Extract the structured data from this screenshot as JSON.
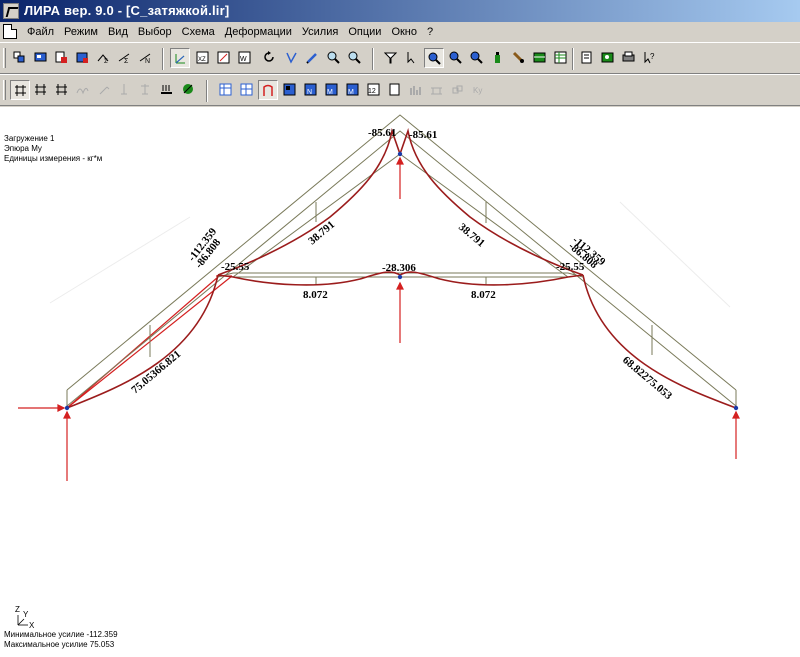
{
  "window": {
    "title": "ЛИРА  вер. 9.0 - [С_затяжкой.lir]"
  },
  "menu": [
    "Файл",
    "Режим",
    "Вид",
    "Выбор",
    "Схема",
    "Деформации",
    "Усилия",
    "Опции",
    "Окно",
    "?"
  ],
  "info": {
    "load_case": "Загружение  1",
    "diagram": "Эпюра My",
    "units": "Единицы измерения - кг*м",
    "min_force": "Минимальное усилие  -112.359",
    "max_force": "Максимальное усилие  75.053"
  },
  "axes": {
    "z": "Z",
    "y": "Y",
    "x": "X"
  },
  "labels": {
    "top_left": "-85.61",
    "top_right": "-85.61",
    "upper_left_rafter": "38.791",
    "upper_right_rafter": "38.791",
    "tie_center": "-28.306",
    "tie_left": "8.072",
    "tie_right": "8.072",
    "left_brace_a": "-112.359",
    "left_brace_b": "-86.808",
    "left_brace_c": "-25.55",
    "right_brace_a": "-112.359",
    "right_brace_b": "-86.808",
    "right_brace_c": "-25.55",
    "left_lower_rafter": "75.05366.821",
    "right_lower_rafter": "68.82275.053"
  },
  "colors": {
    "moment": "#9b1c1c",
    "structure": "#7a7a5a",
    "support": "#d42020",
    "node": "#1a3aa8"
  },
  "toolbar1": [
    "add-node",
    "add-element",
    "delete-node",
    "delete-element",
    "pack-nodes",
    "pack-elements",
    "axis-zoom",
    "zoom-fit",
    "zoom-3d",
    "rotate",
    "projection",
    "edit",
    "magnifier",
    "zoom-window",
    "filter",
    "flag",
    "zoom-in",
    "zoom-out",
    "zoom-reset",
    "pointer-plus",
    "pencil",
    "shelf",
    "table",
    "notepad",
    "book",
    "printer-settings",
    "help"
  ],
  "toolbar2": [
    "node-grid",
    "frame",
    "hinge-frame",
    "spring",
    "hook",
    "pin",
    "cross-pin",
    "load-arrows",
    "color-scheme",
    "stress-grid",
    "grid-selected",
    "moment-diagram",
    "fill-black",
    "fill-blue-n",
    "fill-blue-m",
    "fill-blue-m2",
    "number-12",
    "doc-page",
    "bar-chart",
    "bridge",
    "cubes",
    "ky-label"
  ]
}
